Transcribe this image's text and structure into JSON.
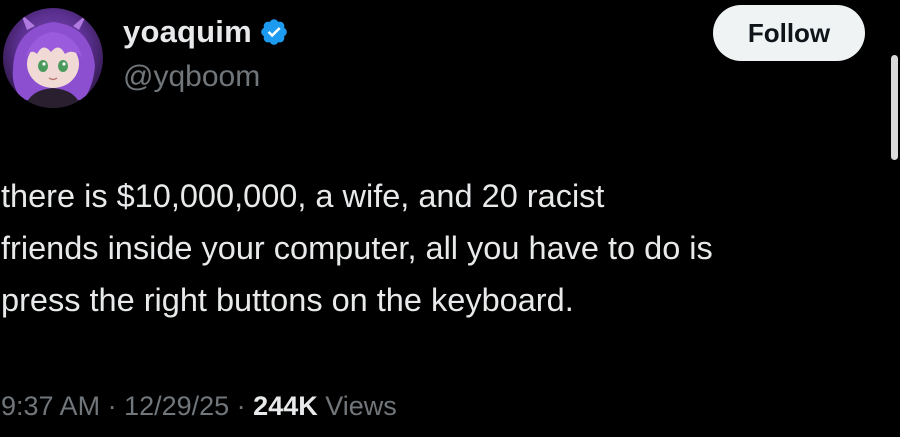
{
  "author": {
    "display_name": "yoaquim",
    "handle": "@yqboom",
    "verified_icon": "verified-badge-icon",
    "avatar_icon": "anime-avatar-icon"
  },
  "follow_button": {
    "label": "Follow"
  },
  "tweet": {
    "lines": [
      "there is $10,000,000, a wife, and 20 racist",
      "friends inside your computer, all you have to do is",
      "press the right buttons on the keyboard."
    ]
  },
  "meta": {
    "time": "9:37 AM",
    "separator": " · ",
    "date": "12/29/25",
    "views_count": "244K",
    "views_label": "Views"
  },
  "colors": {
    "background": "#000000",
    "text_primary": "#e7e9ea",
    "text_secondary": "#71767b",
    "verified_blue": "#1d9bf0",
    "follow_bg": "#eff3f4"
  }
}
